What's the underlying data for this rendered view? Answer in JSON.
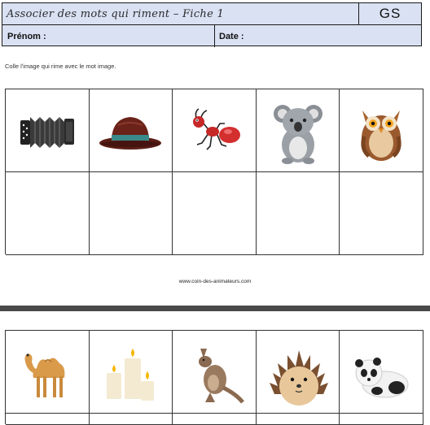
{
  "header": {
    "title": "Associer des mots qui riment – Fiche 1",
    "level": "GS",
    "prenom_label": "Prénom :",
    "date_label": "Date :"
  },
  "instruction": "Colle l'image qui rime avec le mot image.",
  "website": "www.coin-des-animateurs.com",
  "sheet1": {
    "images": [
      "accordion-icon",
      "hat-icon",
      "ant-icon",
      "koala-icon",
      "owl-icon"
    ]
  },
  "sheet2": {
    "images": [
      "camel-icon",
      "candles-icon",
      "kangaroo-icon",
      "hedgehog-icon",
      "panda-icon"
    ]
  }
}
